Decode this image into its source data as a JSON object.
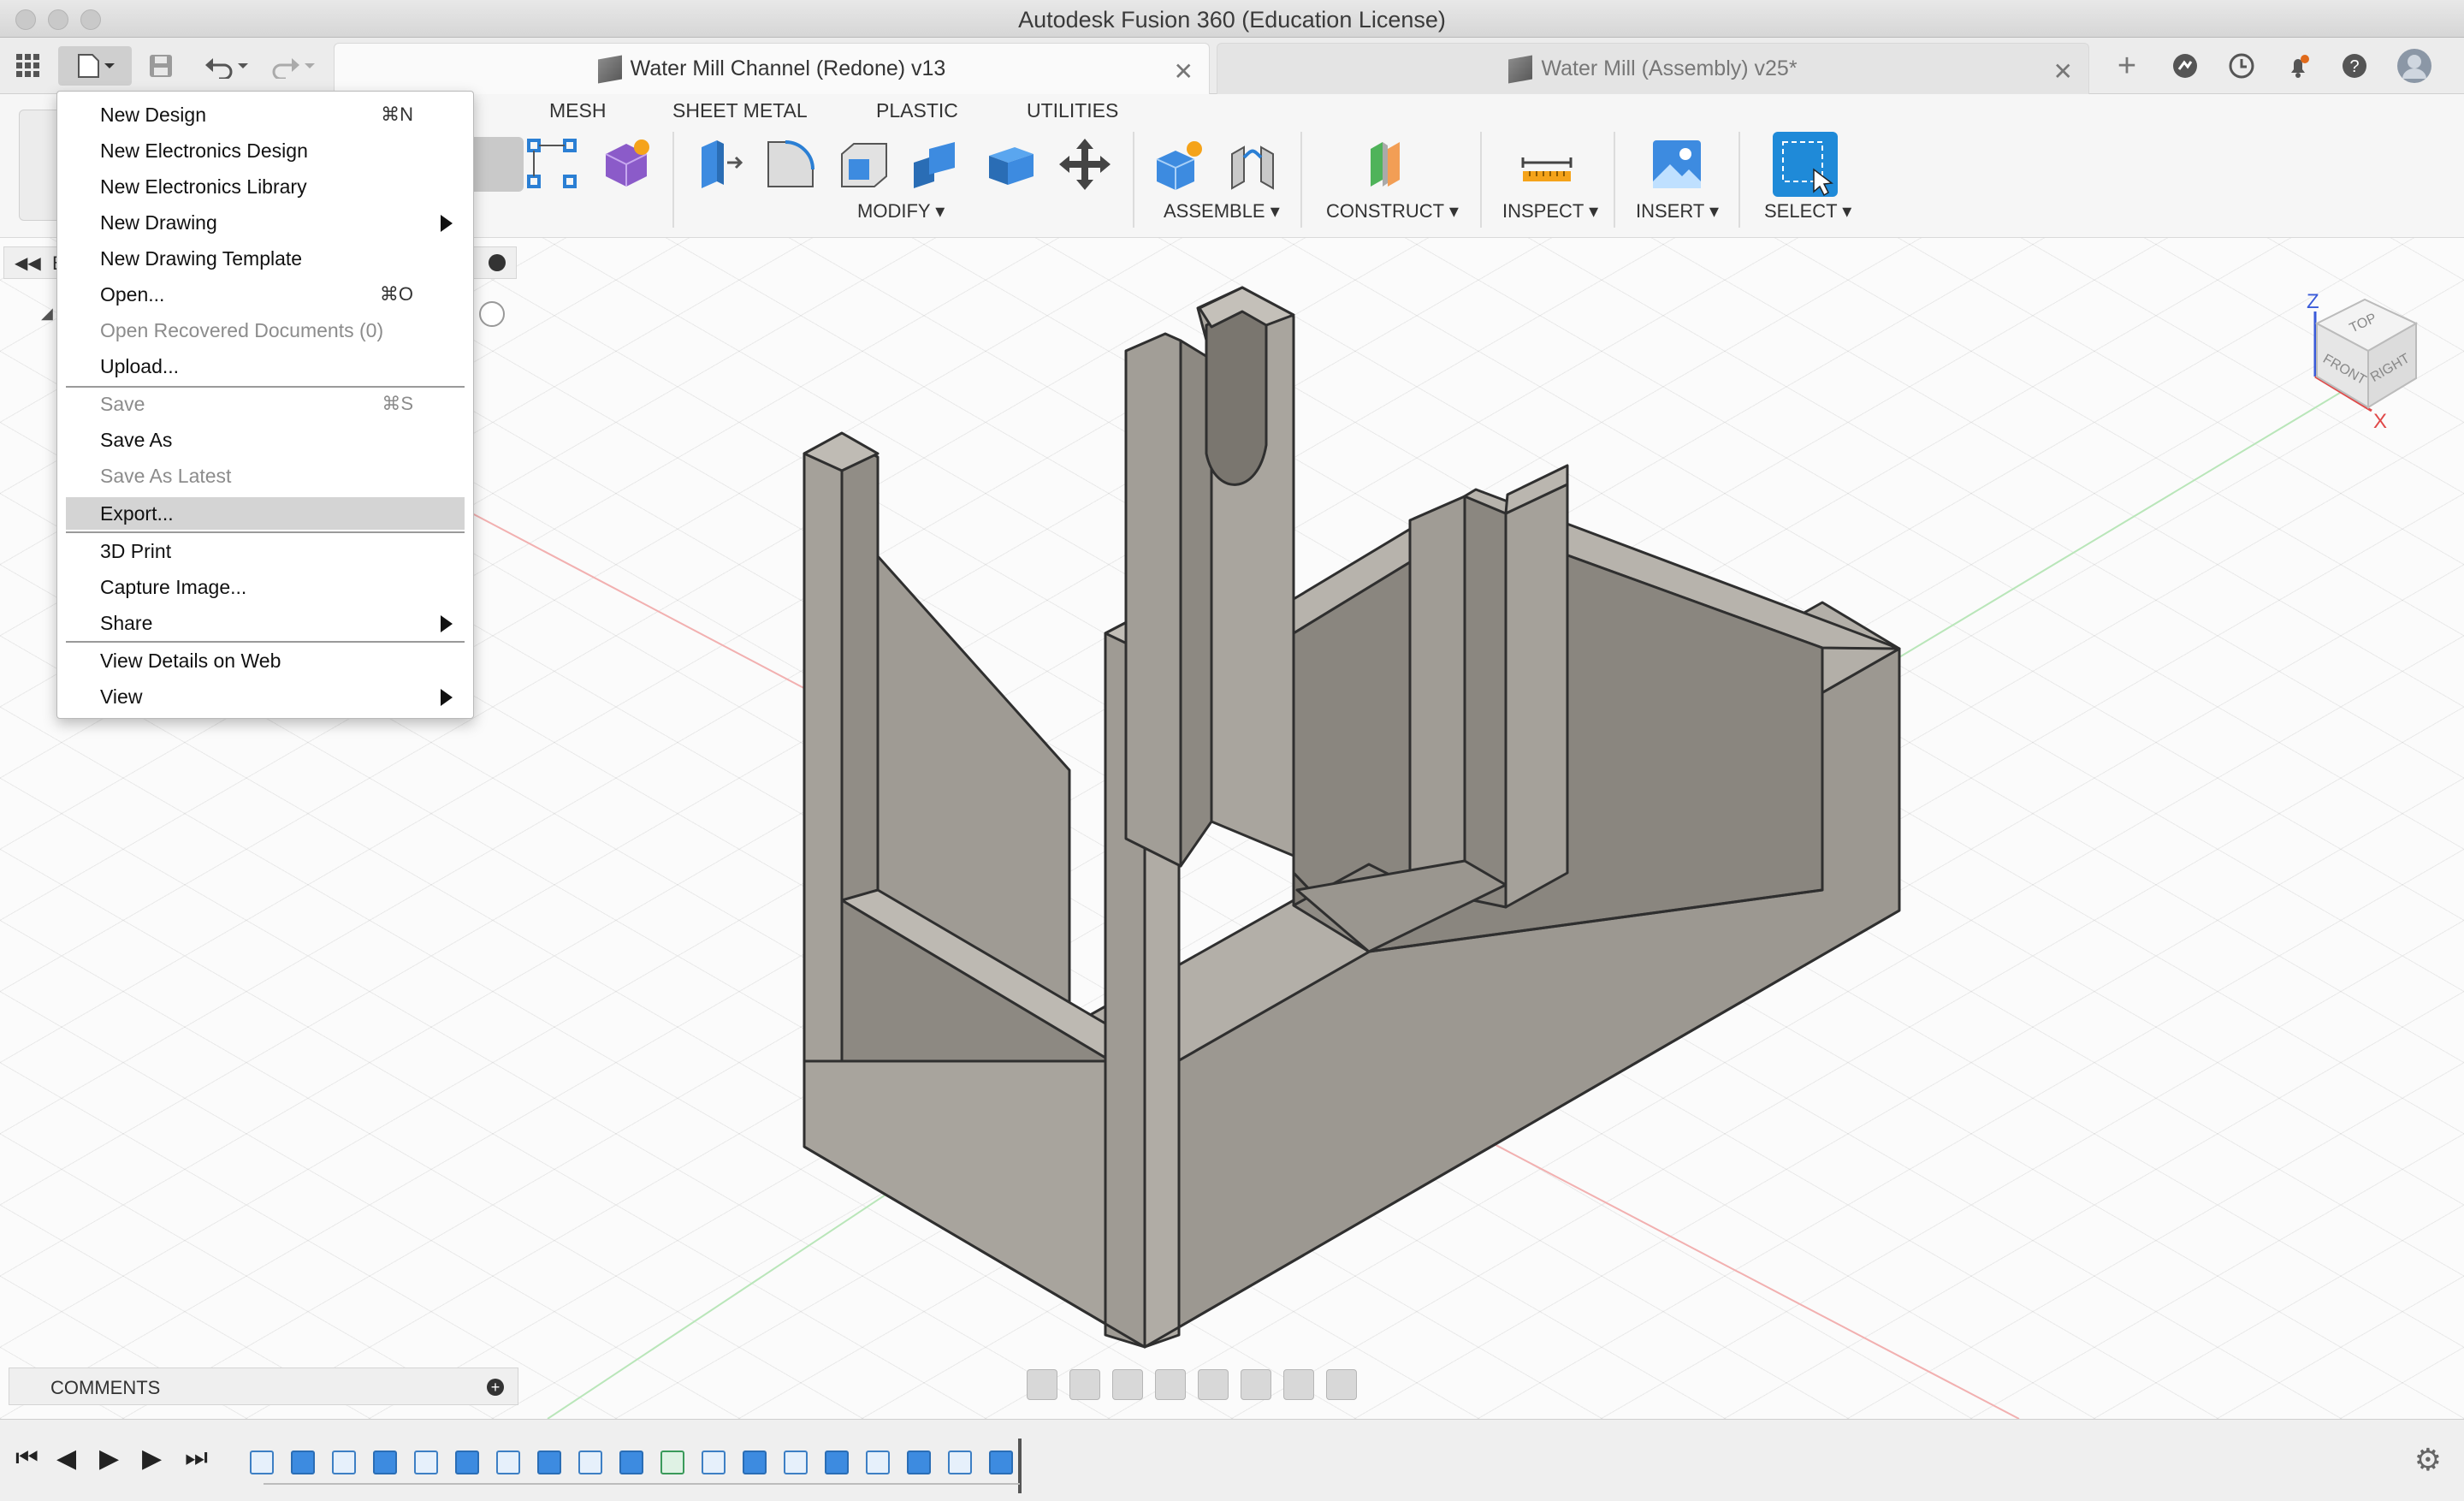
{
  "window": {
    "title": "Autodesk Fusion 360 (Education License)"
  },
  "tabs": [
    {
      "label": "Water Mill Channel (Redone) v13",
      "active": true
    },
    {
      "label": "Water Mill (Assembly) v25*",
      "active": false
    }
  ],
  "ribbon": {
    "tabs": [
      "MESH",
      "SHEET METAL",
      "PLASTIC",
      "UTILITIES"
    ],
    "groups": [
      "MODIFY ▾",
      "ASSEMBLE ▾",
      "CONSTRUCT ▾",
      "INSPECT ▾",
      "INSERT ▾",
      "SELECT ▾"
    ]
  },
  "file_menu": {
    "items": [
      {
        "label": "New Design",
        "shortcut": "⌘N"
      },
      {
        "label": "New Electronics Design",
        "shortcut": ""
      },
      {
        "label": "New Electronics Library",
        "shortcut": ""
      },
      {
        "label": "New Drawing",
        "shortcut": ""
      },
      {
        "label": "New Drawing Template",
        "shortcut": ""
      },
      {
        "label": "Open...",
        "shortcut": "⌘O"
      },
      {
        "label": "Open Recovered Documents (0)",
        "shortcut": ""
      },
      {
        "label": "Upload...",
        "shortcut": ""
      },
      {
        "label": "Save",
        "shortcut": "⌘S"
      },
      {
        "label": "Save As",
        "shortcut": ""
      },
      {
        "label": "Save As Latest",
        "shortcut": ""
      },
      {
        "label": "Export...",
        "shortcut": ""
      },
      {
        "label": "3D Print",
        "shortcut": ""
      },
      {
        "label": "Capture Image...",
        "shortcut": ""
      },
      {
        "label": "Share",
        "shortcut": ""
      },
      {
        "label": "View Details on Web",
        "shortcut": ""
      },
      {
        "label": "View",
        "shortcut": ""
      }
    ],
    "highlighted": "Export..."
  },
  "comments": {
    "label": "COMMENTS"
  },
  "viewcube": {
    "top": "TOP",
    "front": "FRONT",
    "right": "RIGHT",
    "axis_z": "Z",
    "axis_x": "X"
  },
  "browser": {
    "collapsed_label": "B"
  },
  "colors": {
    "accent": "#1f8ad8",
    "model_gray": "#a5a19b",
    "menu_highlight": "#d4d4d4"
  }
}
